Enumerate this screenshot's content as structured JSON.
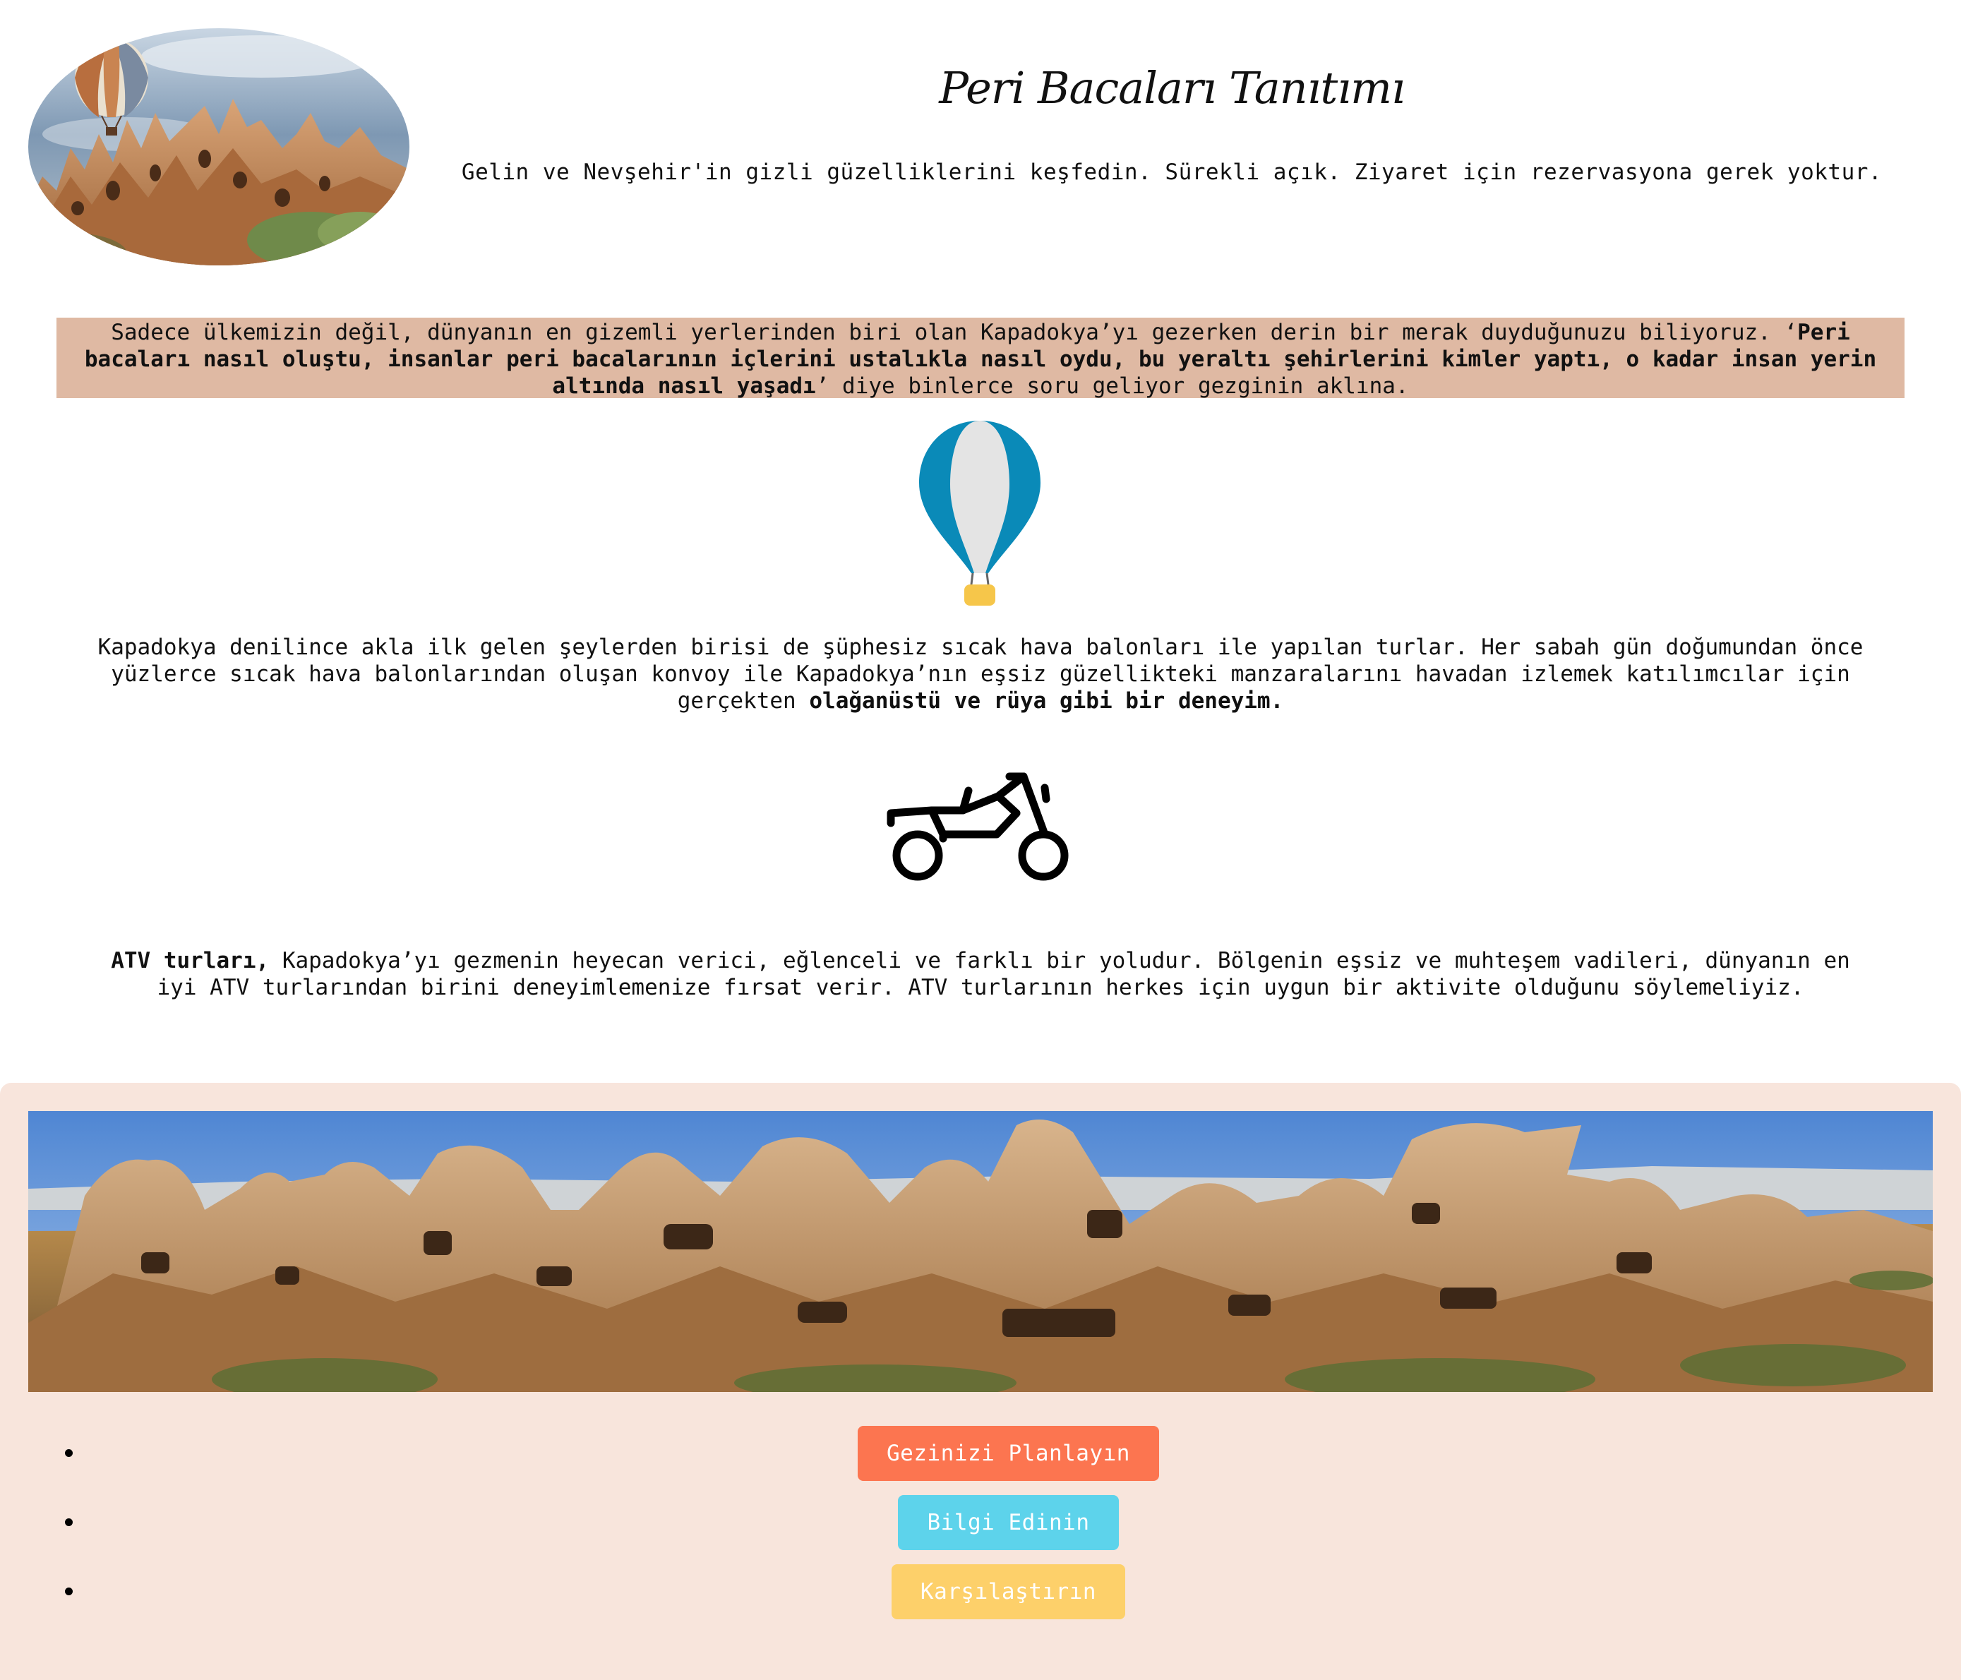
{
  "header": {
    "title": "Peri Bacaları Tanıtımı",
    "tagline": "Gelin ve Nevşehir'in gizli güzelliklerini keşfedin. Sürekli açık. Ziyaret için rezervasyona gerek yoktur."
  },
  "intro": {
    "text_before": "Sadece ülkemizin değil, dünyanın en gizemli yerlerinden biri olan Kapadokya’yı gezerken derin bir merak duyduğunuzu biliyoruz. ‘",
    "bold": "Peri bacaları nasıl oluştu, insanlar peri bacalarının içlerini ustalıkla nasıl oydu, bu yeraltı şehirlerini kimler yaptı, o kadar insan yerin altında nasıl yaşadı",
    "text_after": "’ diye binlerce soru geliyor gezginin aklına."
  },
  "balloon_section": {
    "icon": "hot-air-balloon-icon",
    "text_before": "Kapadokya denilince akla ilk gelen şeylerden birisi de şüphesiz sıcak hava balonları ile yapılan turlar. Her sabah gün doğumundan önce yüzlerce sıcak hava balonlarından oluşan konvoy ile Kapadokya’nın eşsiz güzellikteki manzaralarını havadan izlemek katılımcılar için gerçekten ",
    "bold": "olağanüstü ve rüya gibi bir deneyim."
  },
  "atv_section": {
    "icon": "atv-motorbike-icon",
    "bold": "ATV turları,",
    "text_after": " Kapadokya’yı gezmenin heyecan verici, eğlenceli ve farklı bir yoludur. Bölgenin eşsiz ve muhteşem vadileri, dünyanın en iyi ATV turlarından birini deneyimlemenize fırsat verir. ATV turlarının herkes için uygun bir aktivite olduğunu söylemeliyiz."
  },
  "actions": [
    {
      "label": "Gezinizi Planlayın",
      "color": "#fc7550"
    },
    {
      "label": "Bilgi Edinin",
      "color": "#5dd3eb"
    },
    {
      "label": "Karşılaştırın",
      "color": "#fdd06a"
    }
  ],
  "colors": {
    "intro_background": "#dfb9a3",
    "footer_background": "#f8e5dc",
    "balloon_blue": "#0a8ab8",
    "balloon_basket": "#f6c64a"
  }
}
